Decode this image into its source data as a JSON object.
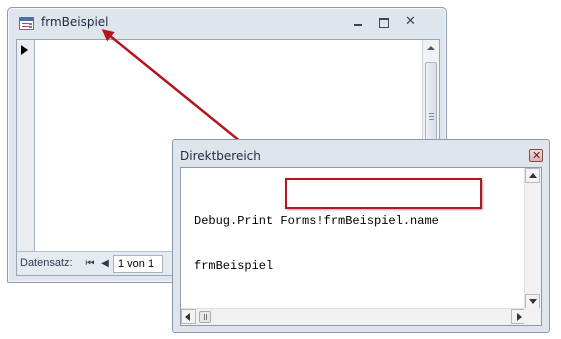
{
  "form_window": {
    "title": "frmBeispiel",
    "icon": "form-icon",
    "buttons": {
      "minimize_icon": "minimize-icon",
      "restore_icon": "restore-icon",
      "close_icon": "close-icon",
      "close_glyph": "✕"
    },
    "nav": {
      "label": "Datensatz:",
      "first_glyph": "⏮",
      "prev_glyph": "◀",
      "record": "1 von 1"
    }
  },
  "immediate_window": {
    "title": "Direktbereich",
    "close_glyph": "✕",
    "lines": [
      "Debug.Print Forms!frmBeispiel.name",
      "frmBeispiel"
    ]
  },
  "annotation": {
    "color": "#b3161b"
  }
}
